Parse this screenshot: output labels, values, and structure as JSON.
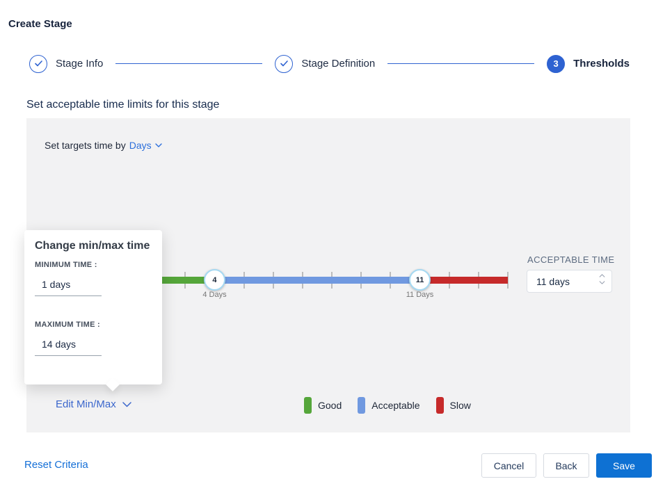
{
  "page": {
    "title": "Create Stage"
  },
  "stepper": {
    "steps": [
      {
        "label": "Stage Info",
        "state": "done"
      },
      {
        "label": "Stage Definition",
        "state": "done"
      },
      {
        "label": "Thresholds",
        "state": "current",
        "number": "3"
      }
    ]
  },
  "section": {
    "heading": "Set acceptable time limits for this stage"
  },
  "targets": {
    "prefix": "Set targets time by",
    "unit": "Days"
  },
  "popup": {
    "title": "Change min/max time",
    "min_label": "MINIMUM TIME :",
    "min_value": "1 days",
    "max_label": "MAXIMUM TIME :",
    "max_value": "14 days"
  },
  "slider": {
    "min_days": 1,
    "max_days": 14,
    "handles": [
      {
        "value": "4",
        "label": "4 Days"
      },
      {
        "value": "11",
        "label": "11 Days"
      }
    ],
    "colors": {
      "good": "#55a63a",
      "acceptable": "#7099e0",
      "slow": "#c62a2a"
    },
    "tick_color": "#bcbcbc"
  },
  "acceptable_time": {
    "label": "ACCEPTABLE TIME",
    "value": "11 days"
  },
  "edit_minmax": {
    "label": "Edit Min/Max"
  },
  "legend": [
    {
      "label": "Good",
      "color": "#55a63a"
    },
    {
      "label": "Acceptable",
      "color": "#7099e0"
    },
    {
      "label": "Slow",
      "color": "#c62a2a"
    }
  ],
  "footer": {
    "reset": "Reset Criteria",
    "cancel": "Cancel",
    "back": "Back",
    "save": "Save"
  }
}
